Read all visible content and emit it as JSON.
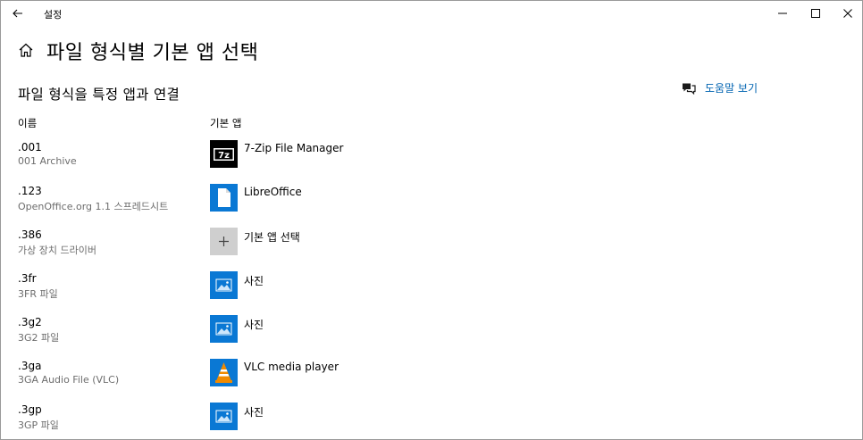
{
  "titlebar": {
    "app_title": "설정"
  },
  "header": {
    "title": "파일 형식별 기본 앱 선택"
  },
  "section": {
    "title": "파일 형식을 특정 앱과 연결",
    "help_link": "도움말 보기"
  },
  "columns": {
    "name": "이름",
    "app": "기본 앱"
  },
  "rows": [
    {
      "ext": ".001",
      "desc": "001 Archive",
      "app": "7-Zip File Manager",
      "icon": "7zip-icon"
    },
    {
      "ext": ".123",
      "desc": "OpenOffice.org 1.1 스프레드시트",
      "app": "LibreOffice",
      "icon": "libreoffice-icon"
    },
    {
      "ext": ".386",
      "desc": "가상 장치 드라이버",
      "app": "기본 앱 선택",
      "icon": "plus-icon"
    },
    {
      "ext": ".3fr",
      "desc": "3FR 파일",
      "app": "사진",
      "icon": "photos-icon"
    },
    {
      "ext": ".3g2",
      "desc": "3G2 파일",
      "app": "사진",
      "icon": "photos-icon"
    },
    {
      "ext": ".3ga",
      "desc": "3GA Audio File (VLC)",
      "app": "VLC media player",
      "icon": "vlc-icon"
    },
    {
      "ext": ".3gp",
      "desc": "3GP 파일",
      "app": "사진",
      "icon": "photos-icon"
    }
  ],
  "colors": {
    "accent": "#0063b1",
    "tile_blue": "#0a78d4",
    "tile_gray": "#cfcfcf",
    "secondary_text": "#6d6d6d"
  }
}
